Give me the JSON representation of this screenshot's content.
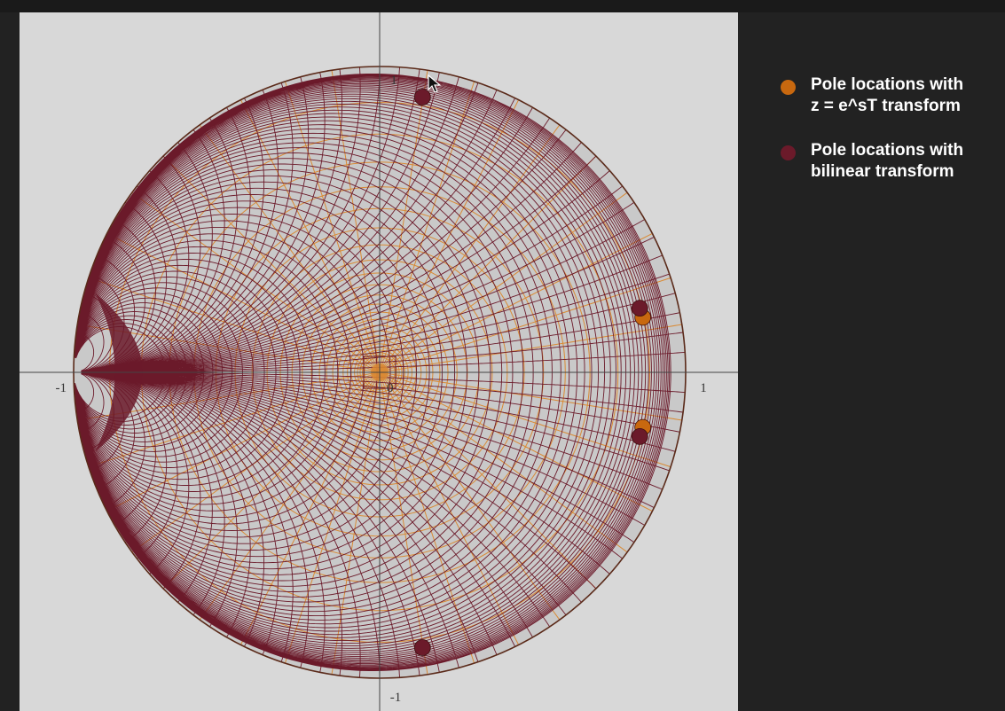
{
  "chart_data": {
    "type": "scatter",
    "title": "",
    "xlabel": "",
    "ylabel": "",
    "xlim": [
      -1.05,
      1.05
    ],
    "ylim": [
      -1.05,
      1.05
    ],
    "grid": "unit-circle z-plane with mapped s-plane grid lines",
    "tick_labels": {
      "x_neg": "-1",
      "origin": "0",
      "x_pos": "1",
      "y_pos": "1",
      "y_neg": "-1"
    },
    "series": [
      {
        "name": "Pole locations with\nz = e^sT transform",
        "color": "#c8680f",
        "points": [
          [
            0.86,
            0.18
          ],
          [
            0.86,
            -0.18
          ]
        ]
      },
      {
        "name": "Pole locations with\nbilinear transform",
        "color": "#6b1a2a",
        "points": [
          [
            0.14,
            0.9
          ],
          [
            0.85,
            0.21
          ],
          [
            0.85,
            -0.21
          ],
          [
            0.14,
            -0.9
          ]
        ]
      }
    ]
  },
  "colors": {
    "panel_bg": "#d8d8d8",
    "disc_fill": "#c9c9c9",
    "exp_grid": "#d98a35",
    "bilinear_grid": "#6b1a2a",
    "axis": "#444444"
  }
}
